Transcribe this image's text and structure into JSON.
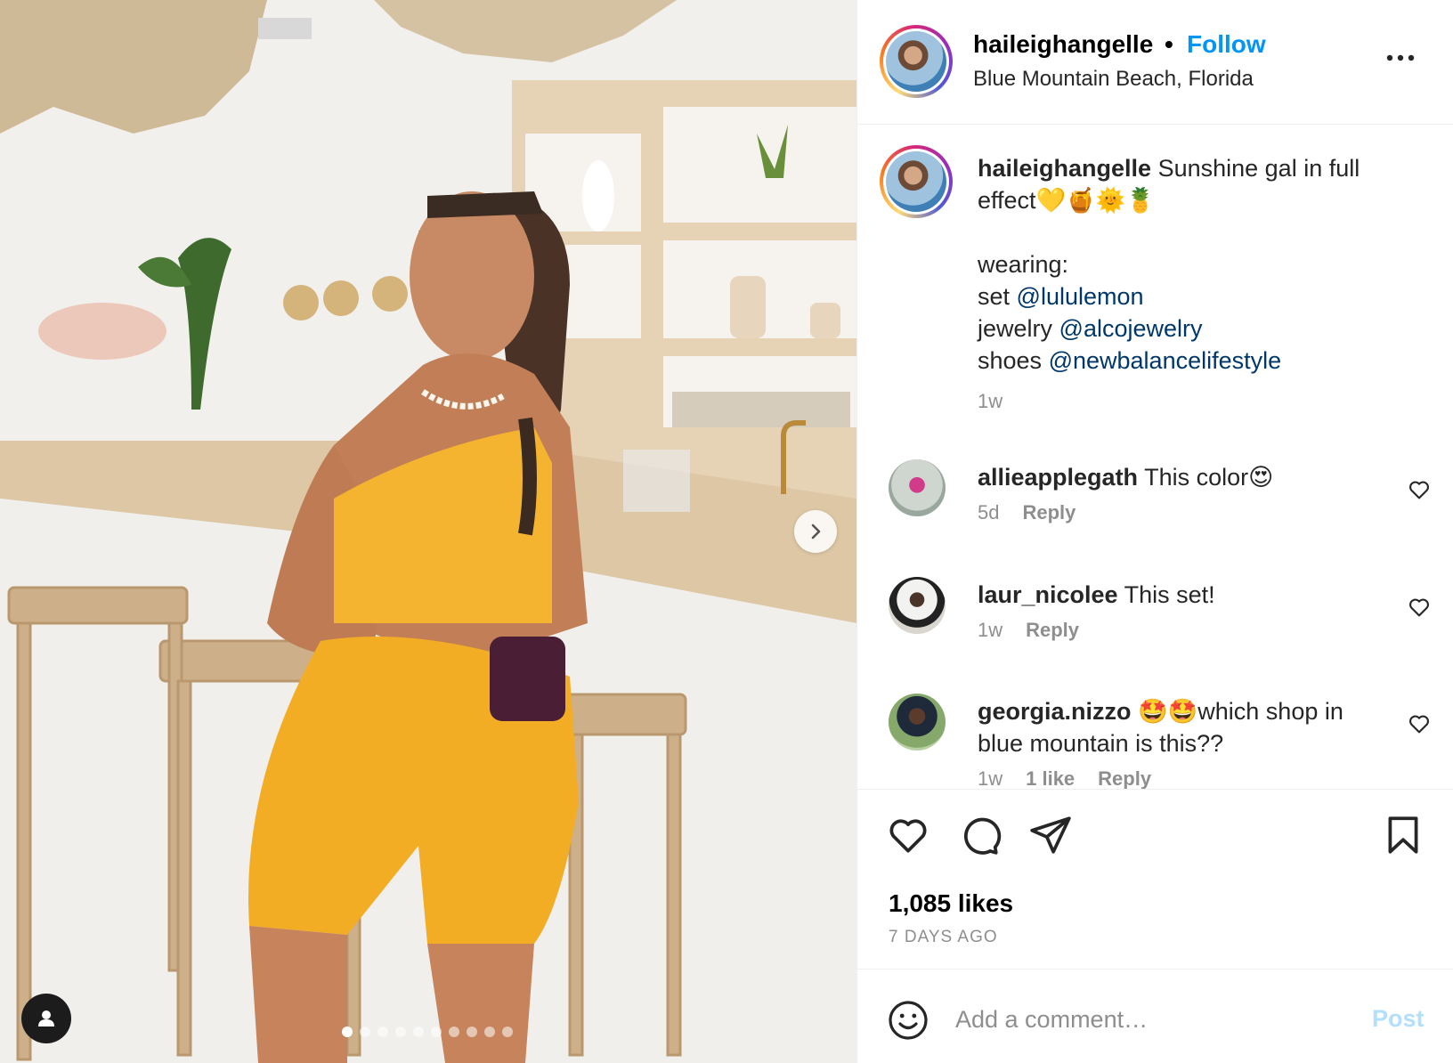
{
  "post": {
    "username": "haileighangelle",
    "follow_label": "Follow",
    "separator": "•",
    "location": "Blue Mountain Beach, Florida",
    "more_icon": "more-horizontal-icon"
  },
  "caption": {
    "username": "haileighangelle",
    "line1": "Sunshine gal in full effect💛🍯🌞🍍",
    "wearing": "wearing:",
    "set_label": "set",
    "set_mention": "@lululemon",
    "jewelry_label": "jewelry",
    "jewelry_mention": "@alcojewelry",
    "shoes_label": "shoes",
    "shoes_mention": "@newbalancelifestyle",
    "time": "1w"
  },
  "comments": [
    {
      "username": "allieapplegath",
      "text": "This color😍",
      "time": "5d",
      "likes": "",
      "reply": "Reply"
    },
    {
      "username": "laur_nicolee",
      "text": "This set!",
      "time": "1w",
      "likes": "",
      "reply": "Reply"
    },
    {
      "username": "georgia.nizzo",
      "text": "🤩🤩which shop in blue mountain is this??",
      "time": "1w",
      "likes": "1 like",
      "reply": "Reply"
    }
  ],
  "stats": {
    "likes": "1,085 likes",
    "posted": "7 DAYS AGO"
  },
  "add_comment": {
    "placeholder": "Add a comment…",
    "post_label": "Post"
  },
  "carousel": {
    "total_slides": 10,
    "active_index": 0
  },
  "colors": {
    "follow": "#0095f6",
    "mention": "#00376b",
    "secondary_text": "#8e8e8e",
    "post_disabled": "#b2dffc",
    "outfit": "#f5b430"
  }
}
